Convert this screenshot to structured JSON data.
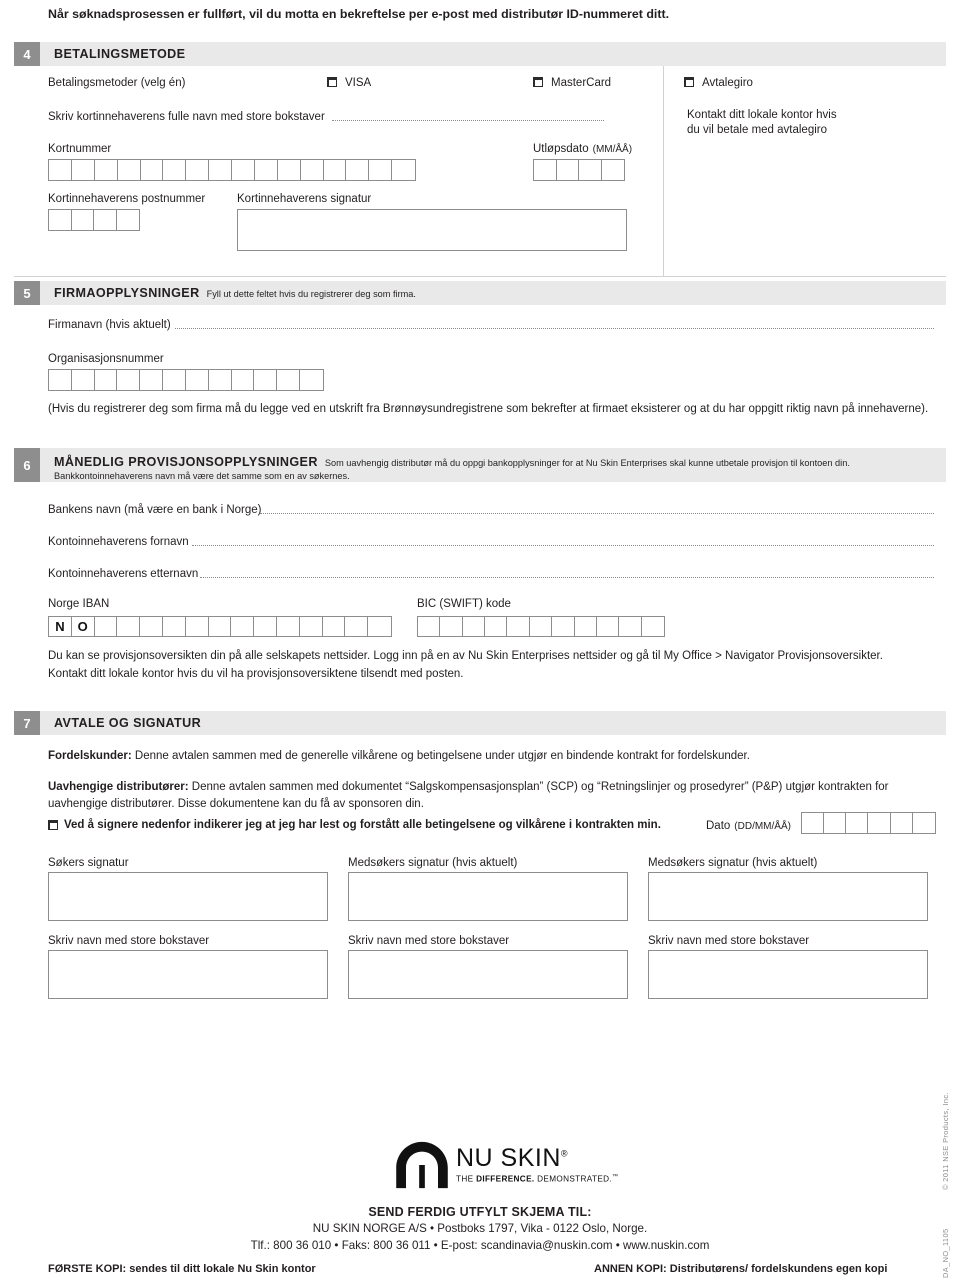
{
  "intro": {
    "text": "Når søknadsprosessen er fullført, vil du motta en bekreftelse per e-post med distributør ID-nummeret ditt."
  },
  "section4": {
    "number": "4",
    "title": "BETALINGSMETODE",
    "payment_label": "Betalingsmetoder (velg én)",
    "options": [
      {
        "label": "VISA",
        "checked": false
      },
      {
        "label": "MasterCard",
        "checked": false
      },
      {
        "label": "Avtalegiro",
        "checked": false
      }
    ],
    "cardholder_name_label": "Skriv kortinnehaverens fulle navn med store bokstaver",
    "cardholder_name_value": "",
    "card_number_label": "Kortnummer",
    "card_number_boxes": 16,
    "card_number_value": "",
    "expiry_label": "Utløpsdato",
    "expiry_format": "(MM/ÅÅ)",
    "expiry_boxes": 4,
    "expiry_value": "",
    "postcode_label": "Kortinnehaverens postnummer",
    "postcode_boxes": 4,
    "postcode_value": "",
    "signature_label": "Kortinnehaverens signatur",
    "signature_value": "",
    "avtalegiro_note_line1": "Kontakt ditt lokale kontor hvis",
    "avtalegiro_note_line2": "du vil betale med avtalegiro"
  },
  "section5": {
    "number": "5",
    "title": "FIRMAOPPLYSNINGER",
    "subtitle": "Fyll ut dette feltet hvis du registrerer deg som firma.",
    "company_name_label": "Firmanavn (hvis aktuelt)",
    "company_name_value": "",
    "org_number_label": "Organisasjonsnummer",
    "org_number_boxes": 12,
    "org_number_value": "",
    "note": "(Hvis du registrerer deg som firma må du legge ved en utskrift fra Brønnøysundregistrene som bekrefter at firmaet eksisterer og at du har oppgitt riktig navn på innehaverne)."
  },
  "section6": {
    "number": "6",
    "title": "MÅNEDLIG PROVISJONSOPPLYSNINGER",
    "subtitle_line1": "Som uavhengig distributør må du oppgi bankopplysninger for at Nu Skin Enterprises skal kunne utbetale provisjon  til kontoen din.",
    "subtitle_line2": "Bankkontoinnehaverens navn må være det samme som en av søkernes.",
    "bank_name_label": "Bankens navn (må være en bank i Norge)",
    "bank_name_value": "",
    "account_firstname_label": "Kontoinnehaverens fornavn",
    "account_firstname_value": "",
    "account_lastname_label": "Kontoinnehaverens etternavn",
    "account_lastname_value": "",
    "iban_label": "Norge IBAN",
    "iban_boxes": 15,
    "iban_prefill": [
      "N",
      "O"
    ],
    "bic_label": "BIC (SWIFT) kode",
    "bic_boxes": 11,
    "bic_value": "",
    "note_line1": "Du kan se provisjonsoversikten din på alle selskapets nettsider. Logg inn på en av Nu Skin Enterprises nettsider og gå til My Office > Navigator Provisjonsoversikter.",
    "note_line2": "Kontakt ditt lokale kontor hvis du vil ha provisjonsoversiktene tilsendt med posten."
  },
  "section7": {
    "number": "7",
    "title": "AVTALE OG SIGNATUR",
    "para1_bold": "Fordelskunder:",
    "para1_rest": " Denne avtalen sammen med de generelle vilkårene og betingelsene under utgjør en bindende kontrakt for fordelskunder.",
    "para2_bold": "Uavhengige distributører:",
    "para2_rest": " Denne avtalen sammen med dokumentet “Salgskompensasjonsplan” (SCP) og “Retningslinjer og prosedyrer” (P&P) utgjør kontrakten for uavhengige distributører. Disse dokumentene kan du få av sponsoren din.",
    "consent_label": "Ved å signere nedenfor indikerer jeg at jeg har lest og forstått alle betingelsene og vilkårene i kontrakten min.",
    "consent_checked": false,
    "date_label": "Dato",
    "date_format": "(DD/MM/ÅÅ)",
    "date_boxes": 6,
    "date_value": "",
    "signature_columns": [
      {
        "signature_label": "Søkers signatur",
        "name_label": "Skriv navn med store bokstaver",
        "signature_value": "",
        "name_value": ""
      },
      {
        "signature_label": "Medsøkers signatur (hvis aktuelt)",
        "name_label": "Skriv navn med store bokstaver",
        "signature_value": "",
        "name_value": ""
      },
      {
        "signature_label": "Medsøkers signatur (hvis aktuelt)",
        "name_label": "Skriv navn med store bokstaver",
        "signature_value": "",
        "name_value": ""
      }
    ]
  },
  "footer": {
    "logo_name": "NU SKIN",
    "logo_reg": "®",
    "logo_tagline_1": "THE ",
    "logo_tagline_2": "DIFFERENCE.",
    "logo_tagline_3": " DEMONSTRATED.",
    "logo_tagline_tm": "™",
    "send_heading": "SEND FERDIG UTFYLT SKJEMA TIL:",
    "address_line": "NU SKIN NORGE A/S  •  Postboks 1797, Vika - 0122 Oslo, Norge.",
    "contact_line": "Tlf.: 800 36 010  •  Faks: 800 36 011  •  E-post: scandinavia@nuskin.com  •  www.nuskin.com",
    "copy_left": "FØRSTE KOPI: sendes til ditt lokale Nu Skin kontor",
    "copy_right": "ANNEN KOPI: Distributørens/ fordelskundens egen kopi",
    "copyright": "© 2011 NSE Products, Inc.",
    "doc_code": "DA_NO_1105"
  },
  "colors": {
    "band_bg": "#e9e9e9",
    "num_bg": "#8e8e8e",
    "ink": "#231f20",
    "rule": "#8d8d8d"
  }
}
